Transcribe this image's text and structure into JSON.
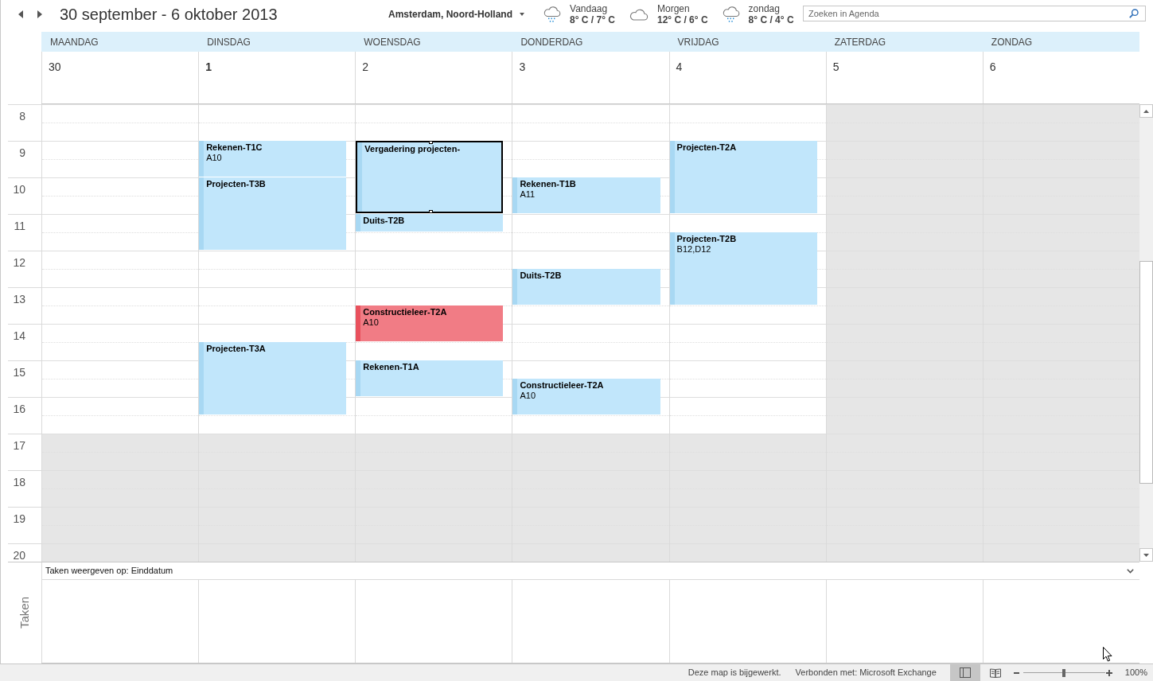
{
  "toolbar": {
    "title": "30 september - 6 oktober 2013",
    "location": "Amsterdam, Noord-Holland",
    "weather": [
      {
        "kind": "rain",
        "day": "Vandaag",
        "temperature": "8° C / 7° C"
      },
      {
        "kind": "cloudy",
        "day": "Morgen",
        "temperature": "12° C / 6° C"
      },
      {
        "kind": "rain",
        "day": "zondag",
        "temperature": "8° C / 4° C"
      }
    ],
    "search": {
      "placeholder": "Zoeken in Agenda"
    }
  },
  "hours": [
    {
      "label": "8",
      "working": true
    },
    {
      "label": "9",
      "working": true
    },
    {
      "label": "10",
      "working": true
    },
    {
      "label": "11",
      "working": true
    },
    {
      "label": "12",
      "working": true
    },
    {
      "label": "13",
      "working": true
    },
    {
      "label": "14",
      "working": true
    },
    {
      "label": "15",
      "working": true
    },
    {
      "label": "16",
      "working": true
    },
    {
      "label": "17",
      "working": false
    },
    {
      "label": "18",
      "working": false
    },
    {
      "label": "19",
      "working": false
    },
    {
      "label": "20",
      "working": false
    }
  ],
  "days": [
    {
      "name": "MAANDAG",
      "date": "30",
      "today": false,
      "workday": true,
      "slots": [
        {
          "kind": "free"
        },
        {
          "kind": "free"
        },
        {
          "kind": "free"
        },
        {
          "kind": "free"
        },
        {
          "kind": "free"
        },
        {
          "kind": "free"
        },
        {
          "kind": "free"
        },
        {
          "kind": "free"
        },
        {
          "kind": "free"
        },
        {
          "kind": "free"
        },
        {
          "kind": "free"
        },
        {
          "kind": "free"
        },
        {
          "kind": "free"
        },
        {
          "kind": "free"
        },
        {
          "kind": "free"
        },
        {
          "kind": "free"
        },
        {
          "kind": "free"
        },
        {
          "kind": "free"
        },
        {
          "kind": "free"
        },
        {
          "kind": "free"
        },
        {
          "kind": "free"
        },
        {
          "kind": "free"
        },
        {
          "kind": "free"
        },
        {
          "kind": "free"
        },
        {
          "kind": "free"
        }
      ]
    },
    {
      "name": "DINSDAG",
      "date": "1",
      "today": true,
      "workday": true,
      "slots": [
        {
          "kind": "free"
        },
        {
          "kind": "free"
        },
        {
          "kind": "appointment",
          "title": "Rekenen-T1C",
          "location": "A10",
          "color": "#c1e6fb",
          "selected": false
        },
        {
          "kind": "continued"
        },
        {
          "kind": "appointment",
          "title": "Projecten-T3B",
          "color": "#c1e6fb",
          "selected": false
        },
        {
          "kind": "continued"
        },
        {
          "kind": "continued"
        },
        {
          "kind": "continued"
        },
        {
          "kind": "free"
        },
        {
          "kind": "free"
        },
        {
          "kind": "free"
        },
        {
          "kind": "free"
        },
        {
          "kind": "free"
        },
        {
          "kind": "appointment",
          "title": "Projecten-T3A",
          "color": "#c1e6fb",
          "selected": false
        },
        {
          "kind": "continued"
        },
        {
          "kind": "continued"
        },
        {
          "kind": "continued"
        },
        {
          "kind": "free"
        },
        {
          "kind": "free"
        },
        {
          "kind": "free"
        },
        {
          "kind": "free"
        },
        {
          "kind": "free"
        },
        {
          "kind": "free"
        },
        {
          "kind": "free"
        },
        {
          "kind": "free"
        }
      ]
    },
    {
      "name": "WOENSDAG",
      "date": "2",
      "today": false,
      "workday": true,
      "slots": [
        {
          "kind": "free"
        },
        {
          "kind": "free"
        },
        {
          "kind": "appointment",
          "title": "Vergadering projecten-",
          "color": "#c1e6fb",
          "selected": true
        },
        {
          "kind": "continued"
        },
        {
          "kind": "continued"
        },
        {
          "kind": "continued"
        },
        {
          "kind": "appointment",
          "title": "Duits-T2B",
          "color": "#c1e6fb",
          "selected": false
        },
        {
          "kind": "free"
        },
        {
          "kind": "free"
        },
        {
          "kind": "free"
        },
        {
          "kind": "free"
        },
        {
          "kind": "appointment",
          "title": "Constructieleer-T2A",
          "location": "A10",
          "color": "#f17c85",
          "selected": false
        },
        {
          "kind": "continued"
        },
        {
          "kind": "free"
        },
        {
          "kind": "appointment",
          "title": "Rekenen-T1A",
          "color": "#c1e6fb",
          "selected": false
        },
        {
          "kind": "continued"
        },
        {
          "kind": "free"
        },
        {
          "kind": "free"
        },
        {
          "kind": "free"
        },
        {
          "kind": "free"
        },
        {
          "kind": "free"
        },
        {
          "kind": "free"
        },
        {
          "kind": "free"
        },
        {
          "kind": "free"
        },
        {
          "kind": "free"
        }
      ]
    },
    {
      "name": "DONDERDAG",
      "date": "3",
      "today": false,
      "workday": true,
      "slots": [
        {
          "kind": "free"
        },
        {
          "kind": "free"
        },
        {
          "kind": "free"
        },
        {
          "kind": "free"
        },
        {
          "kind": "appointment",
          "title": "Rekenen-T1B",
          "location": "A11",
          "color": "#c1e6fb",
          "selected": false
        },
        {
          "kind": "continued"
        },
        {
          "kind": "free"
        },
        {
          "kind": "free"
        },
        {
          "kind": "free"
        },
        {
          "kind": "appointment",
          "title": "Duits-T2B",
          "color": "#c1e6fb",
          "selected": false
        },
        {
          "kind": "continued"
        },
        {
          "kind": "free"
        },
        {
          "kind": "free"
        },
        {
          "kind": "free"
        },
        {
          "kind": "free"
        },
        {
          "kind": "appointment",
          "title": "Constructieleer-T2A",
          "location": "A10",
          "color": "#c1e6fb",
          "selected": false
        },
        {
          "kind": "continued"
        },
        {
          "kind": "free"
        },
        {
          "kind": "free"
        },
        {
          "kind": "free"
        },
        {
          "kind": "free"
        },
        {
          "kind": "free"
        },
        {
          "kind": "free"
        },
        {
          "kind": "free"
        },
        {
          "kind": "free"
        }
      ]
    },
    {
      "name": "VRIJDAG",
      "date": "4",
      "today": false,
      "workday": true,
      "slots": [
        {
          "kind": "free"
        },
        {
          "kind": "free"
        },
        {
          "kind": "appointment",
          "title": "Projecten-T2A",
          "color": "#c1e6fb",
          "selected": false
        },
        {
          "kind": "continued"
        },
        {
          "kind": "continued"
        },
        {
          "kind": "continued"
        },
        {
          "kind": "free"
        },
        {
          "kind": "appointment",
          "title": "Projecten-T2B",
          "location": "B12,D12",
          "color": "#c1e6fb",
          "selected": false
        },
        {
          "kind": "continued"
        },
        {
          "kind": "continued"
        },
        {
          "kind": "continued"
        },
        {
          "kind": "free"
        },
        {
          "kind": "free"
        },
        {
          "kind": "free"
        },
        {
          "kind": "free"
        },
        {
          "kind": "free"
        },
        {
          "kind": "free"
        },
        {
          "kind": "free"
        },
        {
          "kind": "free"
        },
        {
          "kind": "free"
        },
        {
          "kind": "free"
        },
        {
          "kind": "free"
        },
        {
          "kind": "free"
        },
        {
          "kind": "free"
        },
        {
          "kind": "free"
        }
      ]
    },
    {
      "name": "ZATERDAG",
      "date": "5",
      "today": false,
      "workday": false,
      "slots": [
        {
          "kind": "free"
        },
        {
          "kind": "free"
        },
        {
          "kind": "free"
        },
        {
          "kind": "free"
        },
        {
          "kind": "free"
        },
        {
          "kind": "free"
        },
        {
          "kind": "free"
        },
        {
          "kind": "free"
        },
        {
          "kind": "free"
        },
        {
          "kind": "free"
        },
        {
          "kind": "free"
        },
        {
          "kind": "free"
        },
        {
          "kind": "free"
        },
        {
          "kind": "free"
        },
        {
          "kind": "free"
        },
        {
          "kind": "free"
        },
        {
          "kind": "free"
        },
        {
          "kind": "free"
        },
        {
          "kind": "free"
        },
        {
          "kind": "free"
        },
        {
          "kind": "free"
        },
        {
          "kind": "free"
        },
        {
          "kind": "free"
        },
        {
          "kind": "free"
        },
        {
          "kind": "free"
        }
      ]
    },
    {
      "name": "ZONDAG",
      "date": "6",
      "today": false,
      "workday": false,
      "slots": [
        {
          "kind": "free"
        },
        {
          "kind": "free"
        },
        {
          "kind": "free"
        },
        {
          "kind": "free"
        },
        {
          "kind": "free"
        },
        {
          "kind": "free"
        },
        {
          "kind": "free"
        },
        {
          "kind": "free"
        },
        {
          "kind": "free"
        },
        {
          "kind": "free"
        },
        {
          "kind": "free"
        },
        {
          "kind": "free"
        },
        {
          "kind": "free"
        },
        {
          "kind": "free"
        },
        {
          "kind": "free"
        },
        {
          "kind": "free"
        },
        {
          "kind": "free"
        },
        {
          "kind": "free"
        },
        {
          "kind": "free"
        },
        {
          "kind": "free"
        },
        {
          "kind": "free"
        },
        {
          "kind": "free"
        },
        {
          "kind": "free"
        },
        {
          "kind": "free"
        },
        {
          "kind": "free"
        }
      ]
    }
  ],
  "tasks": {
    "label": "Taken",
    "show_by": "Taken weergeven op: Einddatum"
  },
  "status_bar": {
    "messages": [
      "Deze map is bijgewerkt.",
      "Verbonden met: Microsoft Exchange"
    ],
    "views": [
      {
        "kind": "normal",
        "selected": true
      },
      {
        "kind": "reading",
        "selected": false
      }
    ],
    "zoom": {
      "level": 0.5,
      "reading": "100%"
    }
  }
}
